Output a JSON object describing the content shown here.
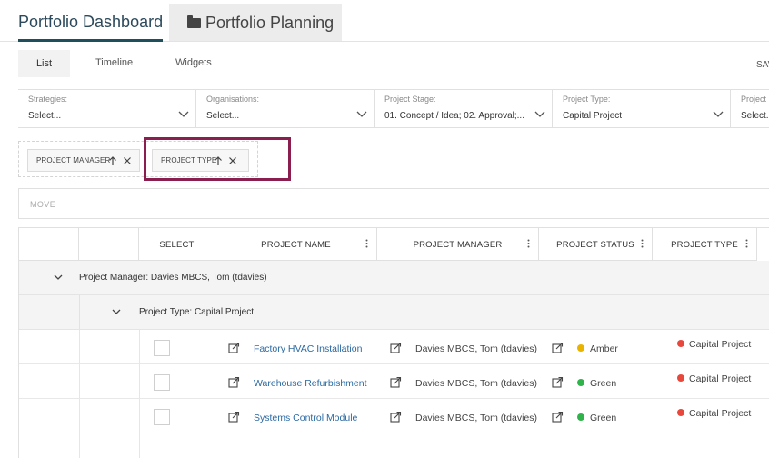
{
  "top_tabs": [
    {
      "label": "Portfolio Dashboard",
      "active": true
    },
    {
      "label": "Portfolio Planning",
      "icon": "folder-icon",
      "active": false
    }
  ],
  "sub_tabs": [
    {
      "label": "List",
      "active": true
    },
    {
      "label": "Timeline"
    },
    {
      "label": "Widgets"
    }
  ],
  "toolbar_right_label": "SAV",
  "filters": [
    {
      "label": "Strategies:",
      "value": "Select..."
    },
    {
      "label": "Organisations:",
      "value": "Select..."
    },
    {
      "label": "Project Stage:",
      "value": "01. Concept / Idea; 02. Approval;..."
    },
    {
      "label": "Project Type:",
      "value": "Capital Project"
    },
    {
      "label": "Project",
      "value": "Select..."
    }
  ],
  "group_chips": [
    {
      "label": "PROJECT MANAGER"
    },
    {
      "label": "PROJECT TYPE"
    }
  ],
  "move_label": "MOVE",
  "columns": [
    "",
    "",
    "SELECT",
    "PROJECT NAME",
    "PROJECT MANAGER",
    "PROJECT STATUS",
    "PROJECT TYPE"
  ],
  "groups": {
    "manager": "Project Manager: Davies MBCS, Tom (tdavies)",
    "type": "Project Type: Capital Project"
  },
  "rows": [
    {
      "name": "Factory HVAC Installation",
      "manager": "Davies MBCS, Tom (tdavies)",
      "status": "Amber",
      "status_color": "#e8b400",
      "type": "Capital Project"
    },
    {
      "name": "Warehouse Refurbishment",
      "manager": "Davies MBCS, Tom (tdavies)",
      "status": "Green",
      "status_color": "#2fb34a",
      "type": "Capital Project"
    },
    {
      "name": "Systems Control Module",
      "manager": "Davies MBCS, Tom (tdavies)",
      "status": "Green",
      "status_color": "#2fb34a",
      "type": "Capital Project"
    }
  ],
  "colors": {
    "accent": "#1f4e5c",
    "highlight": "#8a1f4f",
    "link": "#2b6aa3",
    "type_dot": "#e8483b"
  }
}
